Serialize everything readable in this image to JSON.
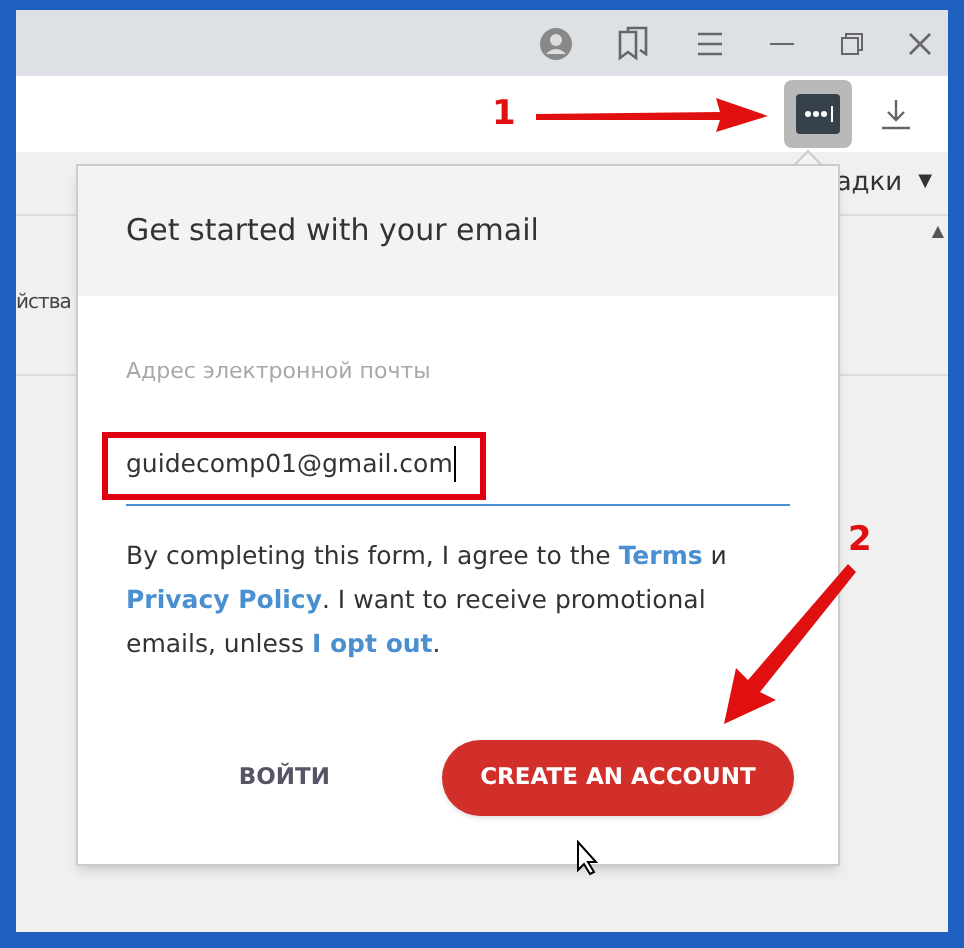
{
  "bookmarks_bar": {
    "label": "адки",
    "caret": "▼"
  },
  "page": {
    "fragment": "йства",
    "scroll_arrow": "▲"
  },
  "popup": {
    "title": "Get started with your email",
    "email_label": "Адрес электронной почты",
    "email_value": "guidecomp01@gmail.com",
    "consent": [
      {
        "text": "By completing this form, I agree to the ",
        "link": false
      },
      {
        "text": "Terms",
        "link": true
      },
      {
        "text": " и ",
        "link": false
      },
      {
        "text": "Privacy Policy",
        "link": true
      },
      {
        "text": ". I want to receive promotional emails, unless ",
        "link": false
      },
      {
        "text": "I opt out",
        "link": true
      },
      {
        "text": ".",
        "link": false
      }
    ],
    "buttons": [
      {
        "label": "ВОЙТИ",
        "kind": "text"
      },
      {
        "label": "CREATE AN ACCOUNT",
        "kind": "primary"
      }
    ]
  },
  "annotations": [
    {
      "number": "1",
      "kind": "right"
    },
    {
      "number": "2",
      "kind": "down-left"
    }
  ]
}
